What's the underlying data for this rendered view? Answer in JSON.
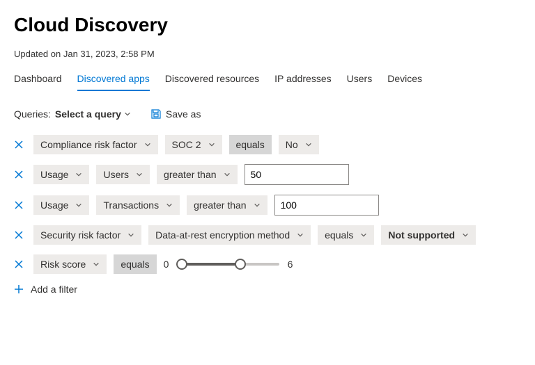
{
  "title": "Cloud Discovery",
  "updated": "Updated on Jan 31, 2023, 2:58 PM",
  "tabs": [
    "Dashboard",
    "Discovered apps",
    "Discovered resources",
    "IP addresses",
    "Users",
    "Devices"
  ],
  "selectedTab": "Discovered apps",
  "queries": {
    "label": "Queries:",
    "select": "Select a query",
    "saveas": "Save as"
  },
  "filters": [
    {
      "category": "Compliance risk factor",
      "sub": "SOC 2",
      "op": "equals",
      "value": "No",
      "valueType": "pill"
    },
    {
      "category": "Usage",
      "sub": "Users",
      "op": "greater than",
      "value": "50",
      "valueType": "input"
    },
    {
      "category": "Usage",
      "sub": "Transactions",
      "op": "greater than",
      "value": "100",
      "valueType": "input"
    },
    {
      "category": "Security risk factor",
      "sub": "Data-at-rest encryption method",
      "op": "equals",
      "value": "Not supported",
      "valueType": "pillStrong"
    },
    {
      "category": "Risk score",
      "op": "equals",
      "valueType": "slider",
      "sliderLow": "0",
      "sliderHigh": "6",
      "min": 0,
      "max": 10
    }
  ],
  "addFilter": "Add a filter"
}
